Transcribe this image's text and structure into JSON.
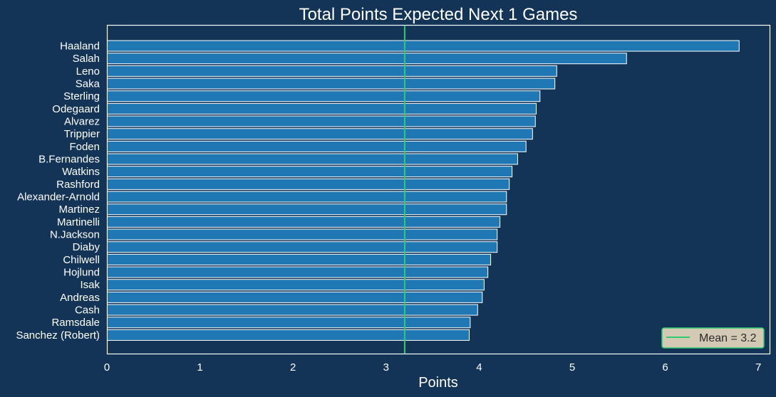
{
  "chart_data": {
    "type": "bar",
    "orientation": "horizontal",
    "title": "Total Points Expected Next 1 Games",
    "xlabel": "Points",
    "ylabel": "",
    "xlim": [
      0,
      7.12
    ],
    "xticks": [
      0,
      1,
      2,
      3,
      4,
      5,
      6,
      7
    ],
    "grid": false,
    "categories": [
      "Haaland",
      "Salah",
      "Leno",
      "Saka",
      "Sterling",
      "Odegaard",
      "Alvarez",
      "Trippier",
      "Foden",
      "B.Fernandes",
      "Watkins",
      "Rashford",
      "Alexander-Arnold",
      "Martinez",
      "Martinelli",
      "N.Jackson",
      "Diaby",
      "Chilwell",
      "Hojlund",
      "Isak",
      "Andreas",
      "Cash",
      "Ramsdale",
      "Sanchez (Robert)"
    ],
    "values": [
      6.79,
      5.58,
      4.83,
      4.81,
      4.65,
      4.61,
      4.6,
      4.57,
      4.5,
      4.41,
      4.35,
      4.32,
      4.29,
      4.29,
      4.22,
      4.19,
      4.19,
      4.12,
      4.09,
      4.05,
      4.03,
      3.98,
      3.9,
      3.89
    ],
    "mean": 3.2,
    "legend": {
      "label": "Mean = 3.2",
      "placement": "lower-right"
    },
    "colors": {
      "background": "#133457",
      "bar": "#1f77b4",
      "bar_edge": "#ffffff",
      "mean_line": "#2ecc71",
      "legend_bg": "#d3c9b4",
      "legend_edge": "#2ecc71"
    }
  }
}
